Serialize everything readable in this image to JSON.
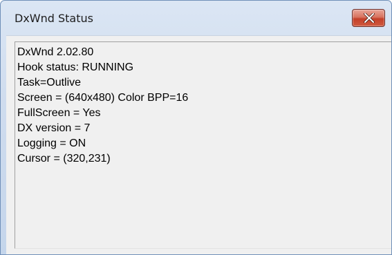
{
  "window": {
    "title": "DxWnd Status",
    "close_icon": "close-icon",
    "colors": {
      "title_bar": "#cfdcee",
      "close_button": "#c4402a",
      "client_background": "#f0f0f0"
    }
  },
  "status": {
    "lines": [
      "DxWnd 2.02.80",
      "Hook status: RUNNING",
      "Task=Outlive",
      "Screen = (640x480) Color BPP=16",
      "FullScreen = Yes",
      "DX version = 7",
      "Logging = ON",
      "Cursor = (320,231)"
    ]
  }
}
